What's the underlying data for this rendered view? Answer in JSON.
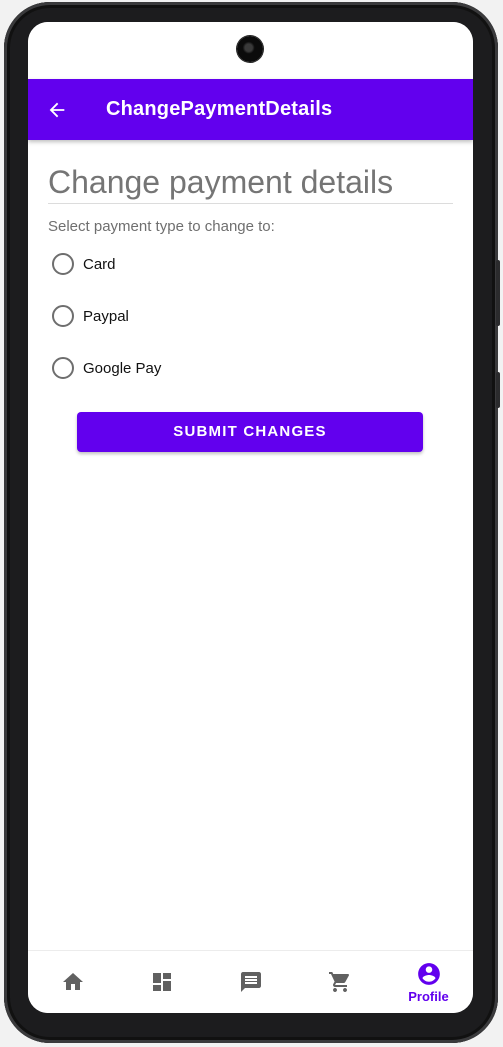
{
  "app_bar": {
    "title": "ChangePaymentDetails",
    "back_icon": "arrow-back-icon",
    "background": "#6200ee"
  },
  "form": {
    "heading": "Change payment details",
    "prompt": "Select payment type to change to:",
    "options": [
      {
        "label": "Card",
        "selected": false
      },
      {
        "label": "Paypal",
        "selected": false
      },
      {
        "label": "Google Pay",
        "selected": false
      }
    ],
    "submit_label": "SUBMIT CHANGES"
  },
  "bottom_nav": {
    "items": [
      {
        "icon": "home-icon",
        "label": "",
        "active": false
      },
      {
        "icon": "dashboard-icon",
        "label": "",
        "active": false
      },
      {
        "icon": "message-icon",
        "label": "",
        "active": false
      },
      {
        "icon": "cart-icon",
        "label": "",
        "active": false
      },
      {
        "icon": "account-circle-icon",
        "label": "Profile",
        "active": true
      }
    ],
    "active_color": "#6200ee",
    "inactive_color": "#616161"
  }
}
